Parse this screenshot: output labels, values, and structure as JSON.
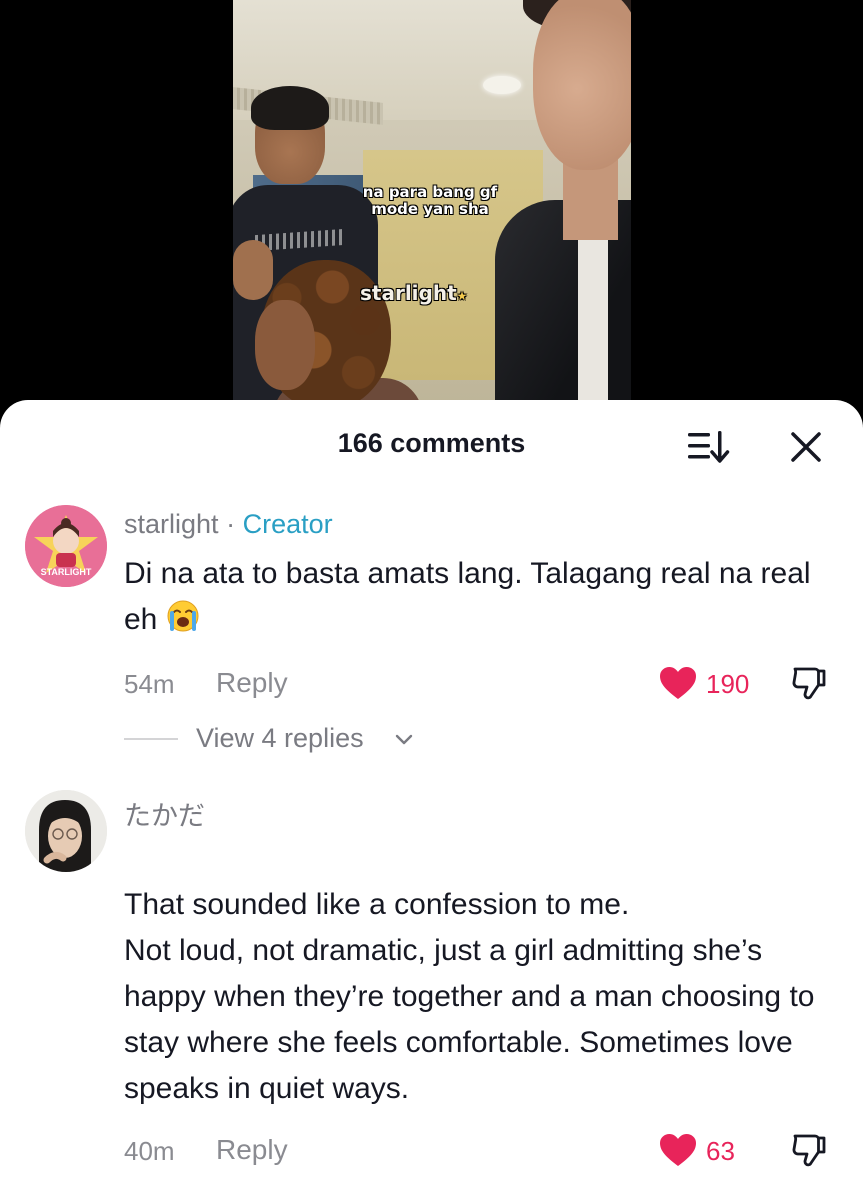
{
  "video": {
    "caption": "na para bang gf\nmode yan sha",
    "watermark": "starlight"
  },
  "comments_panel": {
    "count_label": "166 comments",
    "sort_icon": "sort-icon",
    "close_icon": "close-icon"
  },
  "comments": [
    {
      "username": "starlight",
      "separator": "·",
      "badge": "Creator",
      "text": "Di na ata to basta amats lang. Talagang real na real eh",
      "emoji": "loudly-crying-face",
      "avatar_label": "STARLIGHT",
      "time": "54m",
      "reply_label": "Reply",
      "likes": "190",
      "view_replies": "View 4 replies"
    },
    {
      "username": "たかだ",
      "text": "That sounded like a confession to me.\nNot loud, not dramatic, just a girl admitting she’s happy when they’re together and a man choosing to stay where she feels comfortable. Sometimes love speaks in quiet ways.",
      "time": "40m",
      "reply_label": "Reply",
      "likes": "63"
    }
  ],
  "colors": {
    "like": "#e8245a",
    "creator_badge": "#2a9fc4",
    "text": "#161823",
    "muted": "#8a8b91"
  }
}
